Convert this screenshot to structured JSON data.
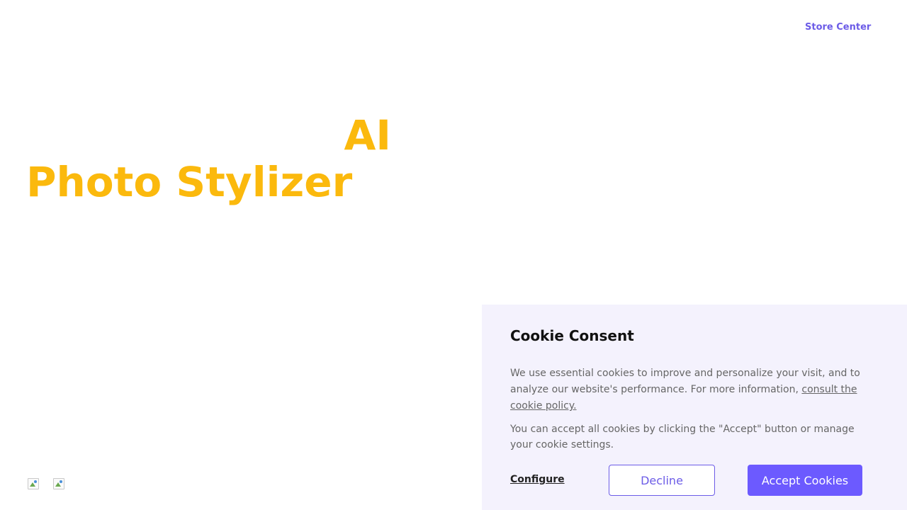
{
  "header": {
    "store_link": "Store Center"
  },
  "hero": {
    "title_line1": "AI",
    "title_line2": "Photo Stylizer"
  },
  "badges": [
    "app-store-badge-icon",
    "google-play-badge-icon"
  ],
  "cookie_banner": {
    "title": "Cookie Consent",
    "paragraph1_text": "We use essential cookies to improve and personalize your visit, and to analyze our website's performance. For more information, ",
    "paragraph1_link": "consult the cookie policy.",
    "paragraph2": "You can accept all cookies by clicking the \"Accept\" button or manage your cookie settings.",
    "configure_label": "Configure",
    "decline_label": "Decline",
    "accept_label": "Accept Cookies"
  },
  "colors": {
    "accent": "#6c5ce7",
    "hero_title": "#fbb90d",
    "panel_bg": "#f4f2fd",
    "accept_bg": "#6c5aff"
  }
}
